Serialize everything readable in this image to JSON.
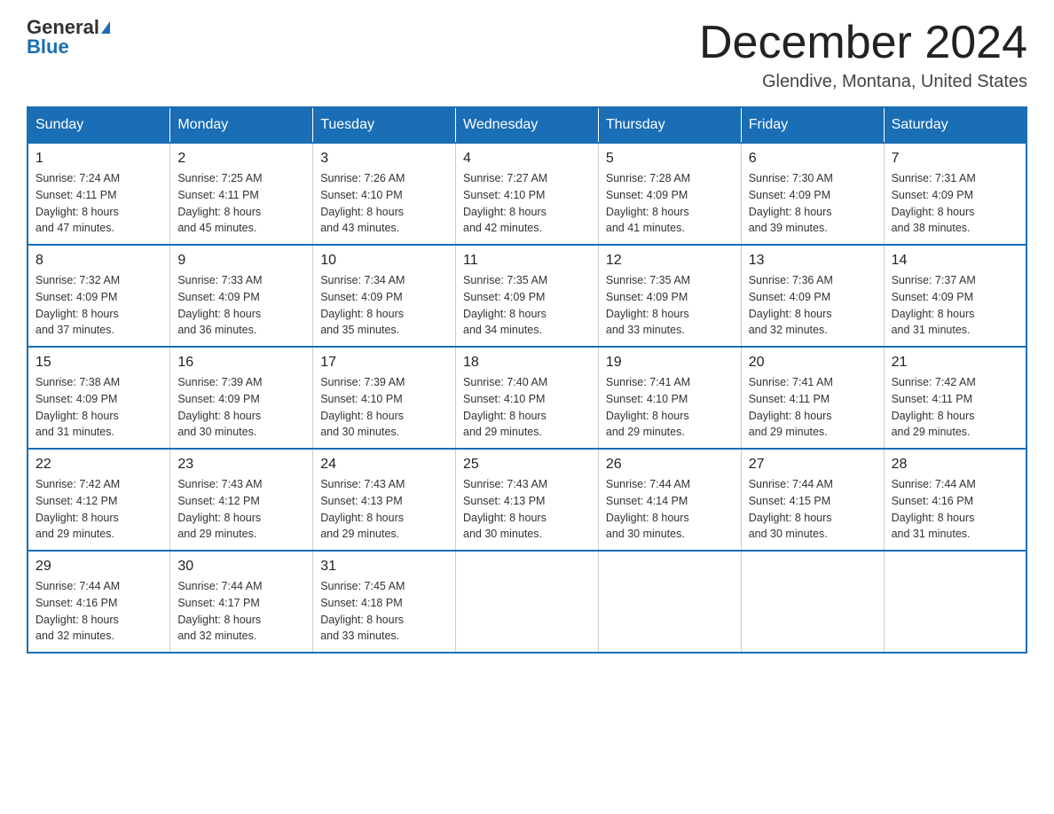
{
  "header": {
    "logo_general": "General",
    "logo_blue": "Blue",
    "title": "December 2024",
    "location": "Glendive, Montana, United States"
  },
  "weekdays": [
    "Sunday",
    "Monday",
    "Tuesday",
    "Wednesday",
    "Thursday",
    "Friday",
    "Saturday"
  ],
  "weeks": [
    [
      {
        "day": "1",
        "sunrise": "7:24 AM",
        "sunset": "4:11 PM",
        "daylight": "8 hours and 47 minutes."
      },
      {
        "day": "2",
        "sunrise": "7:25 AM",
        "sunset": "4:11 PM",
        "daylight": "8 hours and 45 minutes."
      },
      {
        "day": "3",
        "sunrise": "7:26 AM",
        "sunset": "4:10 PM",
        "daylight": "8 hours and 43 minutes."
      },
      {
        "day": "4",
        "sunrise": "7:27 AM",
        "sunset": "4:10 PM",
        "daylight": "8 hours and 42 minutes."
      },
      {
        "day": "5",
        "sunrise": "7:28 AM",
        "sunset": "4:09 PM",
        "daylight": "8 hours and 41 minutes."
      },
      {
        "day": "6",
        "sunrise": "7:30 AM",
        "sunset": "4:09 PM",
        "daylight": "8 hours and 39 minutes."
      },
      {
        "day": "7",
        "sunrise": "7:31 AM",
        "sunset": "4:09 PM",
        "daylight": "8 hours and 38 minutes."
      }
    ],
    [
      {
        "day": "8",
        "sunrise": "7:32 AM",
        "sunset": "4:09 PM",
        "daylight": "8 hours and 37 minutes."
      },
      {
        "day": "9",
        "sunrise": "7:33 AM",
        "sunset": "4:09 PM",
        "daylight": "8 hours and 36 minutes."
      },
      {
        "day": "10",
        "sunrise": "7:34 AM",
        "sunset": "4:09 PM",
        "daylight": "8 hours and 35 minutes."
      },
      {
        "day": "11",
        "sunrise": "7:35 AM",
        "sunset": "4:09 PM",
        "daylight": "8 hours and 34 minutes."
      },
      {
        "day": "12",
        "sunrise": "7:35 AM",
        "sunset": "4:09 PM",
        "daylight": "8 hours and 33 minutes."
      },
      {
        "day": "13",
        "sunrise": "7:36 AM",
        "sunset": "4:09 PM",
        "daylight": "8 hours and 32 minutes."
      },
      {
        "day": "14",
        "sunrise": "7:37 AM",
        "sunset": "4:09 PM",
        "daylight": "8 hours and 31 minutes."
      }
    ],
    [
      {
        "day": "15",
        "sunrise": "7:38 AM",
        "sunset": "4:09 PM",
        "daylight": "8 hours and 31 minutes."
      },
      {
        "day": "16",
        "sunrise": "7:39 AM",
        "sunset": "4:09 PM",
        "daylight": "8 hours and 30 minutes."
      },
      {
        "day": "17",
        "sunrise": "7:39 AM",
        "sunset": "4:10 PM",
        "daylight": "8 hours and 30 minutes."
      },
      {
        "day": "18",
        "sunrise": "7:40 AM",
        "sunset": "4:10 PM",
        "daylight": "8 hours and 29 minutes."
      },
      {
        "day": "19",
        "sunrise": "7:41 AM",
        "sunset": "4:10 PM",
        "daylight": "8 hours and 29 minutes."
      },
      {
        "day": "20",
        "sunrise": "7:41 AM",
        "sunset": "4:11 PM",
        "daylight": "8 hours and 29 minutes."
      },
      {
        "day": "21",
        "sunrise": "7:42 AM",
        "sunset": "4:11 PM",
        "daylight": "8 hours and 29 minutes."
      }
    ],
    [
      {
        "day": "22",
        "sunrise": "7:42 AM",
        "sunset": "4:12 PM",
        "daylight": "8 hours and 29 minutes."
      },
      {
        "day": "23",
        "sunrise": "7:43 AM",
        "sunset": "4:12 PM",
        "daylight": "8 hours and 29 minutes."
      },
      {
        "day": "24",
        "sunrise": "7:43 AM",
        "sunset": "4:13 PM",
        "daylight": "8 hours and 29 minutes."
      },
      {
        "day": "25",
        "sunrise": "7:43 AM",
        "sunset": "4:13 PM",
        "daylight": "8 hours and 30 minutes."
      },
      {
        "day": "26",
        "sunrise": "7:44 AM",
        "sunset": "4:14 PM",
        "daylight": "8 hours and 30 minutes."
      },
      {
        "day": "27",
        "sunrise": "7:44 AM",
        "sunset": "4:15 PM",
        "daylight": "8 hours and 30 minutes."
      },
      {
        "day": "28",
        "sunrise": "7:44 AM",
        "sunset": "4:16 PM",
        "daylight": "8 hours and 31 minutes."
      }
    ],
    [
      {
        "day": "29",
        "sunrise": "7:44 AM",
        "sunset": "4:16 PM",
        "daylight": "8 hours and 32 minutes."
      },
      {
        "day": "30",
        "sunrise": "7:44 AM",
        "sunset": "4:17 PM",
        "daylight": "8 hours and 32 minutes."
      },
      {
        "day": "31",
        "sunrise": "7:45 AM",
        "sunset": "4:18 PM",
        "daylight": "8 hours and 33 minutes."
      },
      null,
      null,
      null,
      null
    ]
  ],
  "labels": {
    "sunrise": "Sunrise:",
    "sunset": "Sunset:",
    "daylight": "Daylight:"
  }
}
